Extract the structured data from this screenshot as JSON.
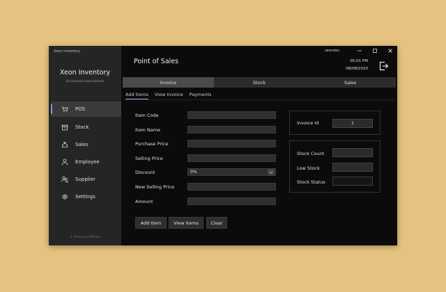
{
  "app": {
    "window_title": "Xeon Inventory",
    "name": "Xeon Inventory",
    "tagline": "Go beyond expectations",
    "copyright": "© Bhanuka Dilhara"
  },
  "sidebar": {
    "items": [
      {
        "label": "POS",
        "icon": "cart-icon",
        "active": true
      },
      {
        "label": "Stock",
        "icon": "box-icon"
      },
      {
        "label": "Sales",
        "icon": "money-bag-icon"
      },
      {
        "label": "Employee",
        "icon": "person-icon"
      },
      {
        "label": "Supplier",
        "icon": "people-icon"
      },
      {
        "label": "Settings",
        "icon": "gear-icon"
      }
    ]
  },
  "header": {
    "user": "xeondev",
    "page_title": "Point of Sales",
    "time": "05:01 PM",
    "date": "08/08/2020"
  },
  "tabs": [
    {
      "label": "Invoice",
      "active": true
    },
    {
      "label": "Stock"
    },
    {
      "label": "Sales"
    }
  ],
  "subtabs": [
    {
      "label": "Add Items",
      "active": true
    },
    {
      "label": "View Invoice"
    },
    {
      "label": "Payments"
    }
  ],
  "form": {
    "item_code": {
      "label": "Item Code",
      "value": ""
    },
    "item_name": {
      "label": "Item Name",
      "value": ""
    },
    "purchase_price": {
      "label": "Purchase Price",
      "value": ""
    },
    "selling_price": {
      "label": "Selling Price",
      "value": ""
    },
    "discount": {
      "label": "Discount",
      "value": "0%"
    },
    "new_selling_price": {
      "label": "New Selling Price",
      "value": ""
    },
    "amount": {
      "label": "Amount",
      "value": ""
    }
  },
  "buttons": {
    "add_item": "Add Item",
    "view_items": "View Items",
    "clear": "Clear"
  },
  "invoice": {
    "label": "Invoice Id",
    "value": "1"
  },
  "stock_info": {
    "count_label": "Stock Count",
    "count_value": "",
    "low_label": "Low Stock",
    "low_value": "",
    "status_label": "Stock Status",
    "status_value": ""
  },
  "colors": {
    "background": "#e6c280",
    "window": "#0b0b0b",
    "sidebar": "#252525",
    "accent": "#7f9ad8"
  }
}
